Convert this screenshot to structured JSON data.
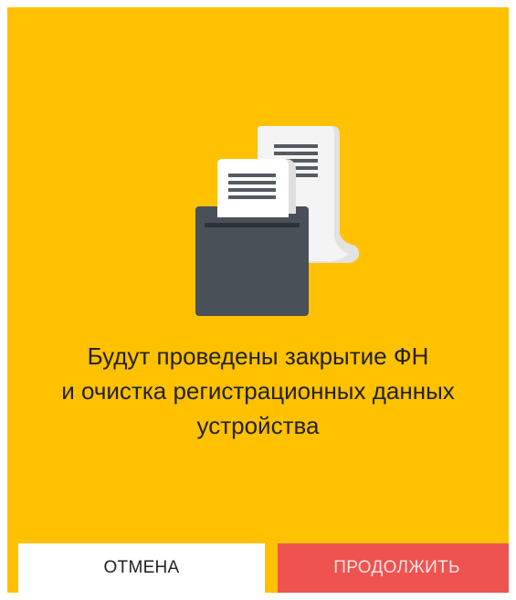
{
  "dialog": {
    "background_color": "#FFC100",
    "illustration": "receipt-printer-icon",
    "message_lines": [
      "Будут проведены закрытие ФН",
      "и очистка регистрационных данных",
      "устройства"
    ],
    "cancel_label": "ОТМЕНА",
    "continue_label": "ПРОДОЛЖИТЬ",
    "continue_color": "#EF5350"
  }
}
